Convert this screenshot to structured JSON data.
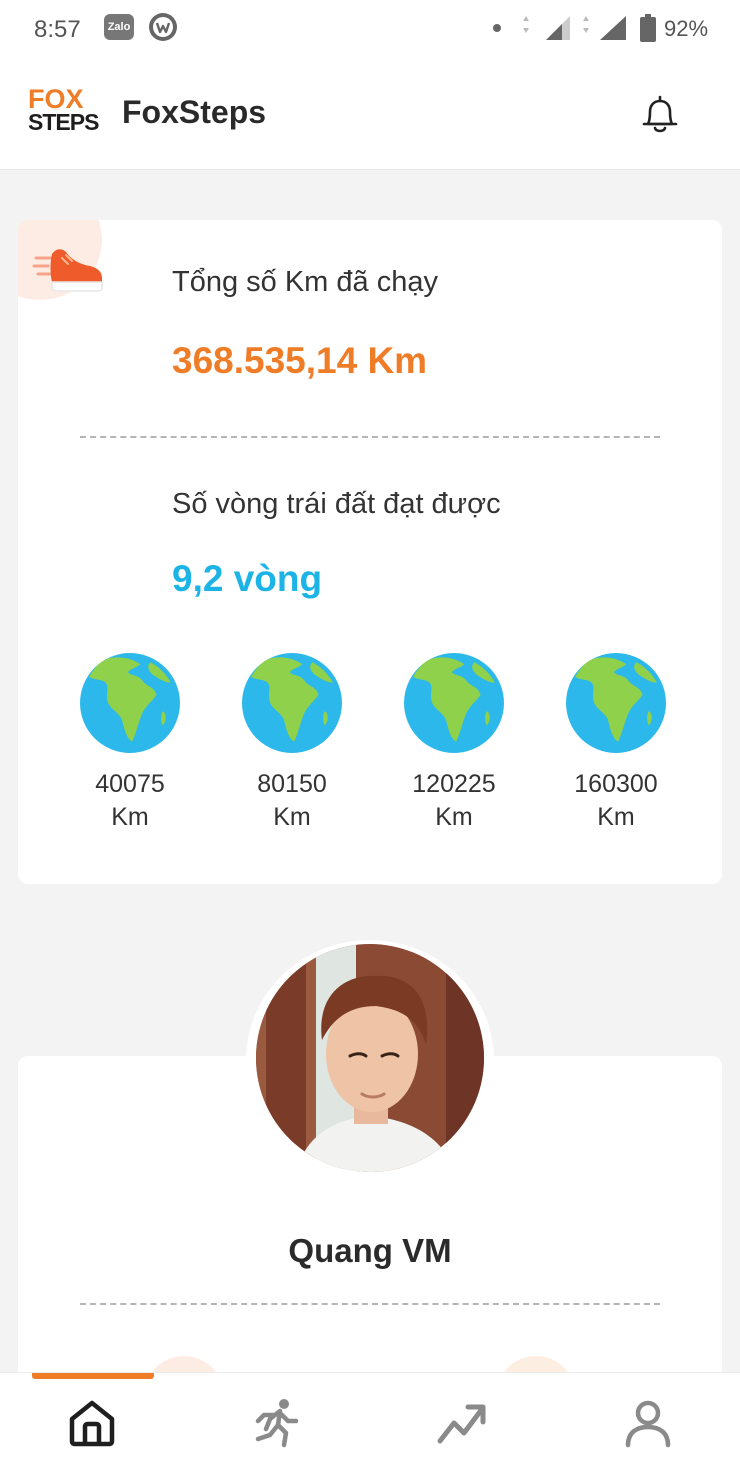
{
  "status_bar": {
    "time": "8:57",
    "notifications": [
      "zalo-icon",
      "w-chat-icon"
    ],
    "zalo_label": "Zalo",
    "battery": "92%"
  },
  "header": {
    "logo_line1": "FOX",
    "logo_line2": "STEPS",
    "title": "FoxSteps",
    "bell_icon": "bell-icon"
  },
  "stats": {
    "total_km_label": "Tổng số Km đã chạy",
    "total_km_value": "368.535,14 Km",
    "earth_loops_label": "Số vòng trái đất đạt được",
    "earth_loops_value": "9,2 vòng",
    "milestones": [
      {
        "value": "40075",
        "unit": "Km"
      },
      {
        "value": "80150",
        "unit": "Km"
      },
      {
        "value": "120225",
        "unit": "Km"
      },
      {
        "value": "160300",
        "unit": "Km"
      }
    ]
  },
  "profile": {
    "name": "Quang VM"
  },
  "bottom_nav": {
    "items": [
      "home-icon",
      "running-icon",
      "trending-up-icon",
      "profile-icon"
    ],
    "active_index": 0
  },
  "colors": {
    "accent_orange": "#ef7c27",
    "accent_blue": "#1cb4e6",
    "background": "#f3f3f3"
  }
}
